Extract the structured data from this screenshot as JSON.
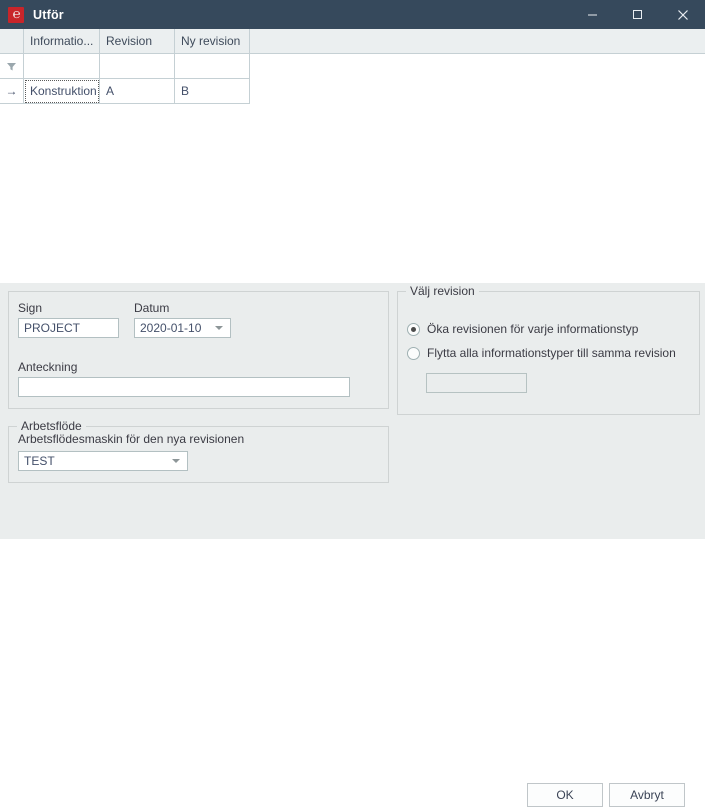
{
  "window": {
    "title": "Utför",
    "icon": "app-logo-icon",
    "controls": {
      "minimize": "minimize-icon",
      "maximize": "maximize-icon",
      "close": "close-icon"
    }
  },
  "grid": {
    "columns": [
      "Informatio...",
      "Revision",
      "Ny revision"
    ],
    "filter_icon": "filter-funnel-icon",
    "filter_values": [
      "",
      "",
      ""
    ],
    "rows": [
      {
        "indicator": "→",
        "cells": [
          "Konstruktion",
          "A",
          "B"
        ]
      }
    ]
  },
  "sign_group": {
    "legend": "",
    "sign_label": "Sign",
    "sign_value": "PROJECT",
    "datum_label": "Datum",
    "datum_value": "2020-01-10",
    "anteckning_label": "Anteckning",
    "anteckning_value": ""
  },
  "workflow_group": {
    "legend": "Arbetsflöde",
    "description": "Arbetsflödesmaskin för den nya revisionen",
    "machine_value": "TEST"
  },
  "revision_group": {
    "legend": "Välj revision",
    "option_increase": "Öka revisionen för varje informationstyp",
    "option_move": "Flytta alla informationstyper till samma revision",
    "selected": "increase",
    "revision_value": ""
  },
  "buttons": {
    "ok": "OK",
    "cancel": "Avbryt"
  },
  "colors": {
    "titlebar": "#36495c",
    "accent_red": "#c8252a",
    "panel": "#eaeded",
    "grid_header": "#ebeff0",
    "grid_line": "#c5d0d4"
  }
}
